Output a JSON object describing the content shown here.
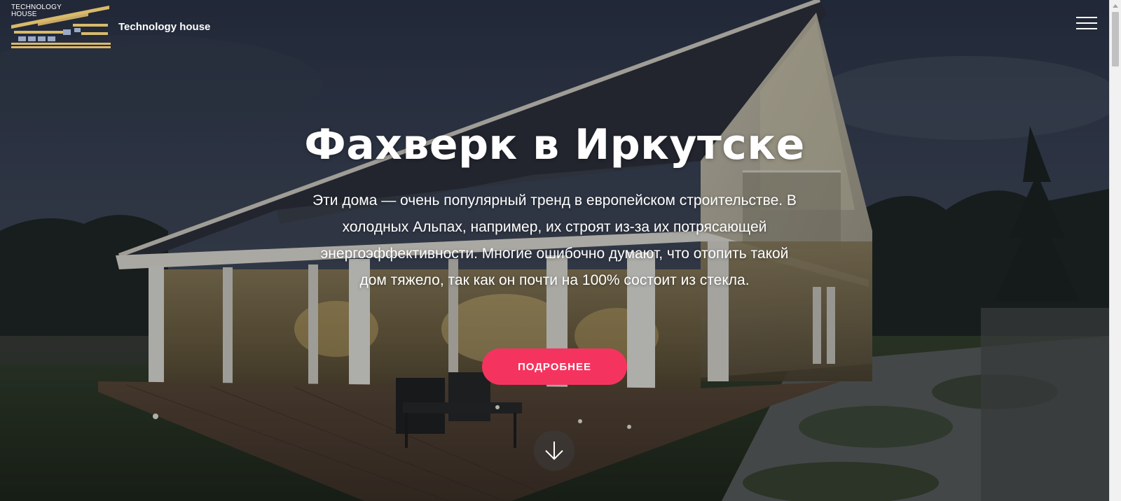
{
  "header": {
    "logo_text": "TECHNOLOGY HOUSE",
    "brand_name": "Technology house",
    "menu_icon": "hamburger-menu-icon"
  },
  "hero": {
    "title": "Фахверк в Иркутске",
    "description": "Эти дома — очень популярный тренд в европейском строительстве. В холодных Альпах, например, их строят из-за их потрясающей энергоэффективности. Многие ошибочно думают, что отопить такой дом тяжело, так как он почти на 100% состоит из стекла.",
    "cta_label": "ПОДРОБНЕЕ",
    "scroll_icon": "arrow-down-icon"
  },
  "colors": {
    "accent": "#f4345f",
    "logo_gold": "#d9b96a",
    "logo_blue": "#9aa9c6",
    "text": "#ffffff"
  },
  "scrollbar": {
    "position": 0
  }
}
